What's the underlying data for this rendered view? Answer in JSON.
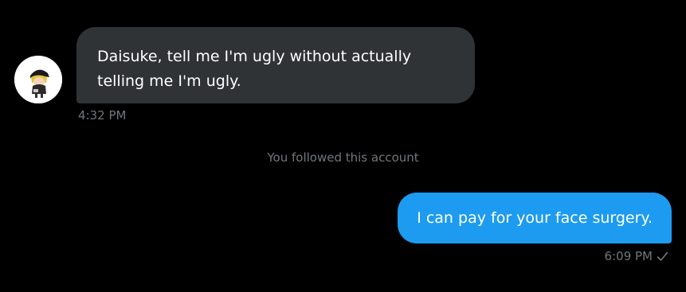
{
  "conversation": {
    "incoming": {
      "avatar_icon": "profile-avatar",
      "text": "Daisuke, tell me I'm ugly without actually telling me I'm ugly.",
      "timestamp": "4:32 PM"
    },
    "system_note": "You followed this account",
    "outgoing": {
      "text": "I can pay for your face surgery.",
      "timestamp": "6:09 PM",
      "status_icon": "check-icon"
    }
  },
  "colors": {
    "background": "#000000",
    "incoming_bubble": "#2f3336",
    "outgoing_bubble": "#1d9bf0",
    "muted_text": "#71767b"
  }
}
